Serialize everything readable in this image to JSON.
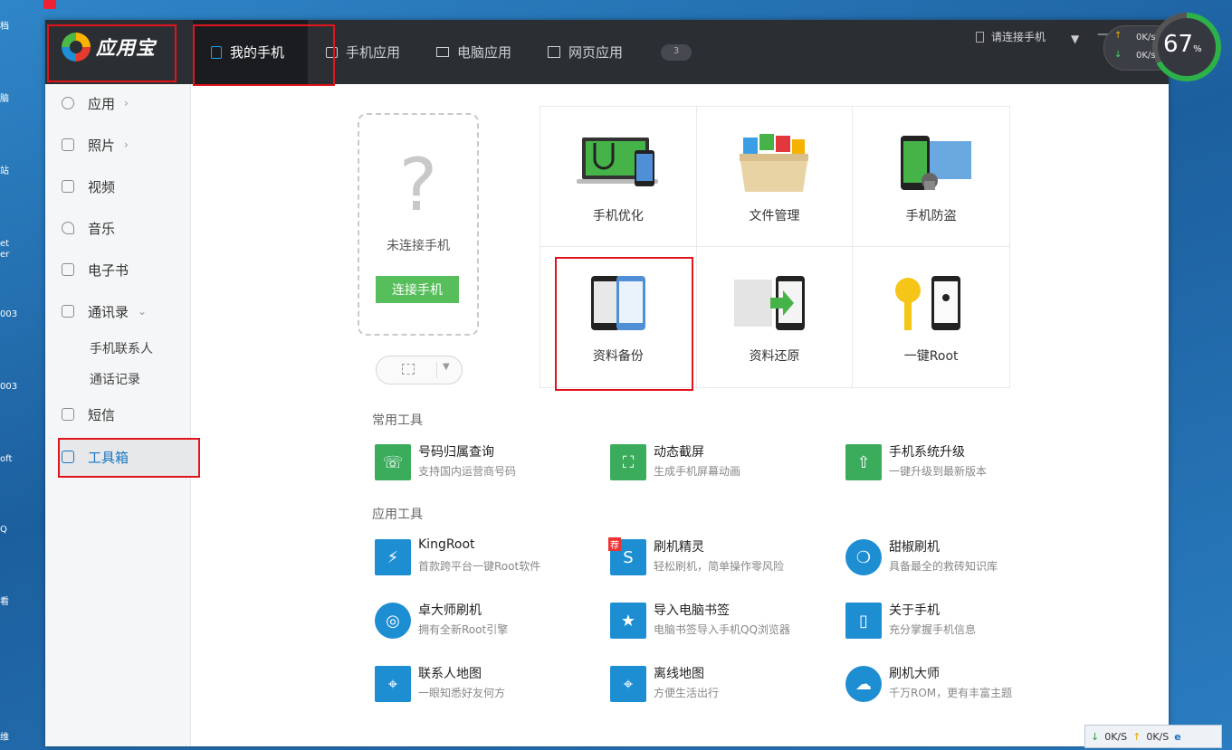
{
  "app": {
    "name": "应用宝"
  },
  "tabs": [
    {
      "label": "我的手机"
    },
    {
      "label": "手机应用"
    },
    {
      "label": "电脑应用"
    },
    {
      "label": "网页应用"
    }
  ],
  "tab_badge": "3",
  "titlebar": {
    "connect_phone": "请连接手机"
  },
  "speed_widget": {
    "upload": "0K/s",
    "download": "0K/s",
    "percent": "67",
    "percent_sign": "%"
  },
  "sidebar": {
    "items": [
      {
        "label": "应用",
        "arrow": "›"
      },
      {
        "label": "照片",
        "arrow": "›"
      },
      {
        "label": "视频"
      },
      {
        "label": "音乐"
      },
      {
        "label": "电子书"
      },
      {
        "label": "通讯录",
        "arrow": "⌄"
      },
      {
        "label": "短信"
      },
      {
        "label": "工具箱"
      }
    ],
    "contacts_sub": [
      "手机联系人",
      "通话记录"
    ]
  },
  "phone_panel": {
    "question": "?",
    "status": "未连接手机",
    "connect_button": "连接手机"
  },
  "grid": [
    {
      "label": "手机优化"
    },
    {
      "label": "文件管理"
    },
    {
      "label": "手机防盗"
    },
    {
      "label": "资料备份"
    },
    {
      "label": "资料还原"
    },
    {
      "label": "一键Root"
    }
  ],
  "sections": {
    "common": "常用工具",
    "app": "应用工具"
  },
  "common_tools": [
    {
      "name": "号码归属查询",
      "desc": "支持国内运营商号码"
    },
    {
      "name": "动态截屏",
      "desc": "生成手机屏幕动画"
    },
    {
      "name": "手机系统升级",
      "desc": "一键升级到最新版本"
    }
  ],
  "app_tools": [
    {
      "name": "KingRoot",
      "desc": "首款跨平台一键Root软件"
    },
    {
      "name": "刷机精灵",
      "desc": "轻松刷机，简单操作零风险",
      "badge": "荐"
    },
    {
      "name": "甜椒刷机",
      "desc": "具备最全的救砖知识库"
    },
    {
      "name": "卓大师刷机",
      "desc": "拥有全新Root引擎"
    },
    {
      "name": "导入电脑书签",
      "desc": "电脑书签导入手机QQ浏览器"
    },
    {
      "name": "关于手机",
      "desc": "充分掌握手机信息"
    },
    {
      "name": "联系人地图",
      "desc": "一眼知悉好友何方"
    },
    {
      "name": "离线地图",
      "desc": "方便生活出行"
    },
    {
      "name": "刷机大师",
      "desc": "千万ROM，更有丰富主题"
    }
  ],
  "tray": {
    "down": "0K/S",
    "up": "0K/S"
  },
  "desktop_labels": [
    "档",
    "脑",
    "站",
    "et",
    "er",
    "003",
    "003",
    "oft",
    "Q",
    "看",
    "维"
  ],
  "colors": {
    "accent": "#1a76c2",
    "green": "#56be5a",
    "highlight": "#e0151b",
    "titlebar": "#2b2e33"
  }
}
